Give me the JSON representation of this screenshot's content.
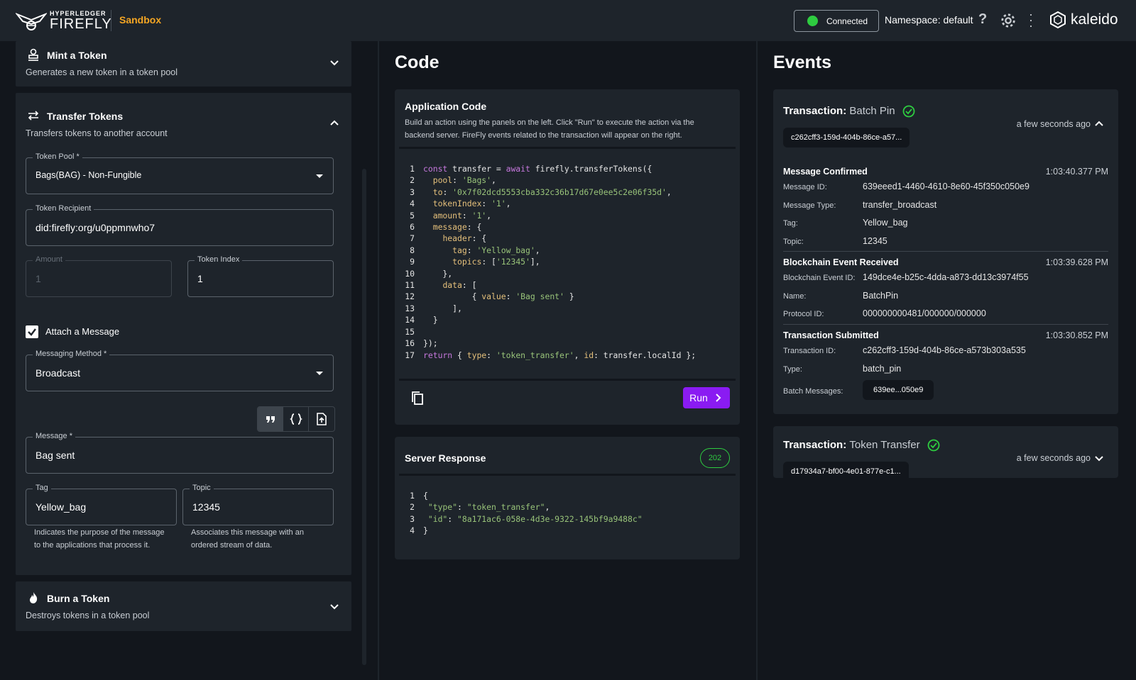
{
  "header": {
    "logo_small": "HYPERLEDGER",
    "logo_big": "FIREFLY",
    "sandbox": "Sandbox",
    "status": "Connected",
    "namespace": "Namespace: default",
    "help": "?",
    "brand": "kaleido",
    "colors": {
      "accent": "#8a1bf2",
      "sandbox": "#f5a623",
      "status_ok": "#2ecc40"
    }
  },
  "left": {
    "mint": {
      "title": "Mint a Token",
      "subtitle": "Generates a new token in a token pool"
    },
    "transfer": {
      "title": "Transfer Tokens",
      "subtitle": "Transfers tokens to another account",
      "token_pool": {
        "label": "Token Pool *",
        "value": "Bags(BAG) - Non-Fungible"
      },
      "recipient": {
        "label": "Token Recipient",
        "value": "did:firefly:org/u0ppmnwho7"
      },
      "amount": {
        "label": "Amount",
        "value": "1"
      },
      "token_index": {
        "label": "Token Index",
        "value": "1"
      },
      "attach": {
        "label": "Attach a Message",
        "checked": true
      },
      "method": {
        "label": "Messaging Method *",
        "value": "Broadcast"
      },
      "message": {
        "label": "Message *",
        "value": "Bag sent"
      },
      "tag": {
        "label": "Tag",
        "value": "Yellow_bag",
        "helper": "Indicates the purpose of the message to the applications that process it."
      },
      "topic": {
        "label": "Topic",
        "value": "12345",
        "helper": "Associates this message with an ordered stream of data."
      }
    },
    "burn": {
      "title": "Burn a Token",
      "subtitle": "Destroys tokens in a token pool"
    }
  },
  "middle": {
    "title": "Code",
    "app_code": {
      "title": "Application Code",
      "desc1": "Build an action using the panels on the left. Click \"Run\" to execute the action via the",
      "desc2": "backend server. FireFly events related to the transaction will appear on the right.",
      "run": "Run"
    },
    "server": {
      "title": "Server Response",
      "status": "202"
    }
  },
  "events": {
    "title": "Events",
    "tx1": {
      "label": "Transaction:",
      "type": "Batch Pin",
      "id": "c262cff3-159d-404b-86ce-a57...",
      "ago": "a few seconds ago",
      "message_confirmed": {
        "title": "Message Confirmed",
        "time": "1:03:40.377 PM",
        "rows": [
          {
            "k": "Message ID:",
            "v": "639eeed1-4460-4610-8e60-45f350c050e9"
          },
          {
            "k": "Message Type:",
            "v": "transfer_broadcast"
          },
          {
            "k": "Tag:",
            "v": "Yellow_bag"
          },
          {
            "k": "Topic:",
            "v": "12345"
          }
        ]
      },
      "blockchain": {
        "title": "Blockchain Event Received",
        "time": "1:03:39.628 PM",
        "rows": [
          {
            "k": "Blockchain Event ID:",
            "v": "149dce4e-b25c-4dda-a873-dd13c3974f55"
          },
          {
            "k": "Name:",
            "v": "BatchPin"
          },
          {
            "k": "Protocol ID:",
            "v": "000000000481/000000/000000"
          }
        ]
      },
      "submitted": {
        "title": "Transaction Submitted",
        "time": "1:03:30.852 PM",
        "rows": [
          {
            "k": "Transaction ID:",
            "v": "c262cff3-159d-404b-86ce-a573b303a535"
          },
          {
            "k": "Type:",
            "v": "batch_pin"
          },
          {
            "k": "Batch Messages:",
            "v": "639ee...050e9"
          }
        ]
      }
    },
    "tx2": {
      "label": "Transaction:",
      "type": "Token Transfer",
      "id": "d17934a7-bf00-4e01-877e-c1...",
      "ago": "a few seconds ago"
    }
  }
}
